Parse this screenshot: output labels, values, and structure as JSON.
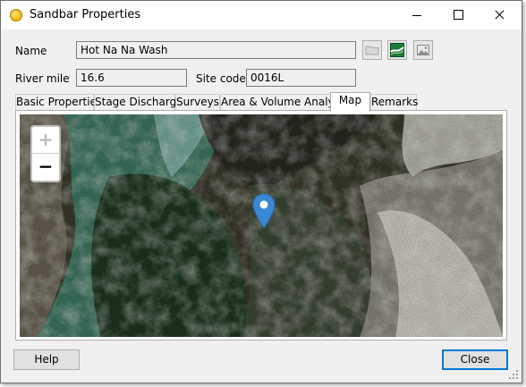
{
  "window": {
    "title": "Sandbar Properties",
    "icon": "sun-icon"
  },
  "fields": {
    "name_label": "Name",
    "name_value": "Hot Na Na Wash",
    "river_mile_label": "River mile",
    "river_mile_value": "16.6",
    "site_code_label": "Site code",
    "site_code_value": "0016L"
  },
  "toolbar_icons": [
    "folder-icon",
    "river-chart-icon",
    "photo-icon"
  ],
  "tabs": [
    {
      "label": "Basic Properties"
    },
    {
      "label": "Stage Discharge"
    },
    {
      "label": "Surveys"
    },
    {
      "label": "Area & Volume Analyses"
    },
    {
      "label": "Map",
      "active": true
    },
    {
      "label": "Remarks"
    }
  ],
  "map": {
    "zoom_in": "+",
    "zoom_out": "−",
    "marker_color": "#3a87d4"
  },
  "buttons": {
    "help": "Help",
    "close": "Close"
  }
}
